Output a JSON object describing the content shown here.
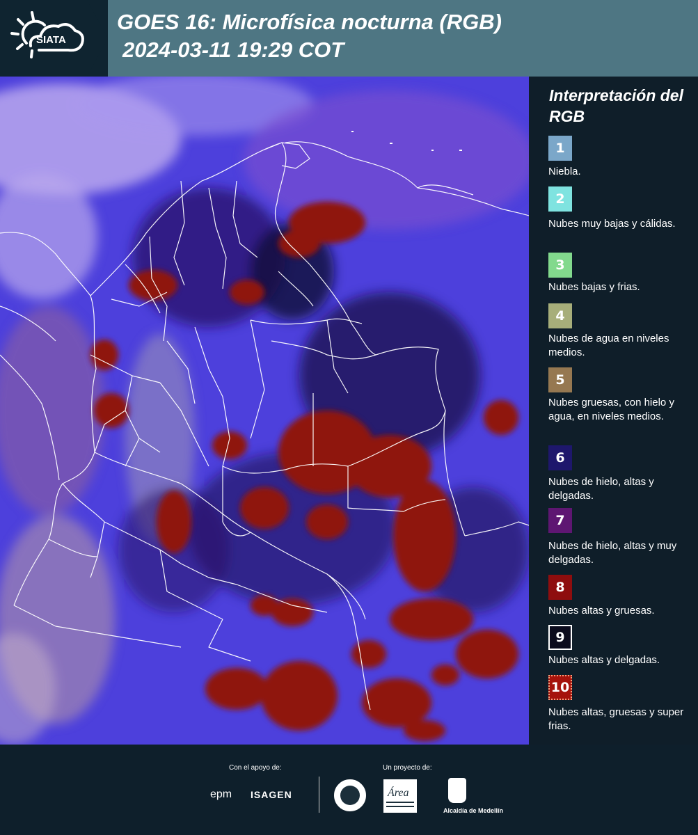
{
  "header": {
    "logo_text": "SIATA",
    "title_line1": "GOES 16: Microfísica nocturna (RGB)",
    "title_line2": "2024-03-11 19:29 COT"
  },
  "legend": {
    "title": "Interpretación del RGB",
    "items": [
      {
        "number": "1",
        "label": "Niebla.",
        "color": "#7ba7c9"
      },
      {
        "number": "2",
        "label": "Nubes muy bajas y cálidas.",
        "color": "#7fe3e0"
      },
      {
        "number": "3",
        "label": "Nubes bajas y frias.",
        "color": "#82d98d"
      },
      {
        "number": "4",
        "label": "Nubes de agua en niveles medios.",
        "color": "#a7ae7a"
      },
      {
        "number": "5",
        "label": "Nubes gruesas, con hielo y agua, en niveles medios.",
        "color": "#967851"
      },
      {
        "number": "6",
        "label": "Nubes de hielo, altas y delgadas.",
        "color": "#1e176c"
      },
      {
        "number": "7",
        "label": "Nubes de hielo, altas y muy delgadas.",
        "color": "#5e1672"
      },
      {
        "number": "8",
        "label": "Nubes altas y gruesas.",
        "color": "#8e0d0e"
      },
      {
        "number": "9",
        "label": "Nubes altas y delgadas.",
        "color": "#0b0b1c"
      },
      {
        "number": "10",
        "label": "Nubes altas, gruesas y super frias.",
        "color": "#a5130c"
      }
    ]
  },
  "footer": {
    "support_label": "Con el apoyo de:",
    "project_label": "Un proyecto de:",
    "epm": "epm",
    "isagen": "ISAGEN",
    "area": "Área",
    "alcaldia": "Alcaldía de Medellín"
  }
}
